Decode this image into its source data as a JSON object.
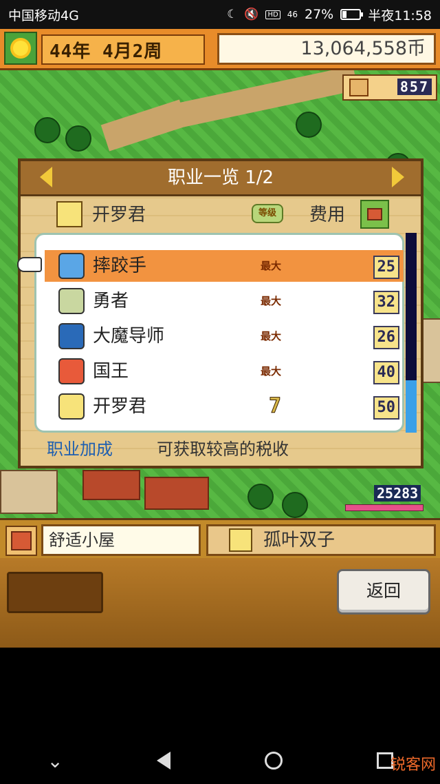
{
  "status_bar": {
    "carrier": "中国移动4G",
    "network": "46",
    "battery": "27%",
    "battery_level": 0.27,
    "time": "半夜11:58"
  },
  "top_bar": {
    "date": "44年 4月2周",
    "money": "13,064,558币",
    "population": "857"
  },
  "job_panel": {
    "title": "职业一览 1/2",
    "current_name": "开罗君",
    "level_badge": "等级",
    "cost_header": "费用",
    "jobs": [
      {
        "name": "摔跤手",
        "level": "最大",
        "cost": "25",
        "selected": true
      },
      {
        "name": "勇者",
        "level": "最大",
        "cost": "32",
        "selected": false
      },
      {
        "name": "大魔导师",
        "level": "最大",
        "cost": "26",
        "selected": false
      },
      {
        "name": "国王",
        "level": "最大",
        "cost": "40",
        "selected": false
      },
      {
        "name": "开罗君",
        "level": "7",
        "cost": "50",
        "selected": false
      }
    ],
    "bonus_label": "职业加成",
    "bonus_desc": "可获取较高的税收"
  },
  "game_overlay": {
    "score": "25283"
  },
  "bottom_info": {
    "house": "舒适小屋",
    "resident": "孤叶双子"
  },
  "buttons": {
    "return": "返回"
  },
  "watermark": "锐客网",
  "colors": {
    "selected_row": "#f29340",
    "accent": "#e88c2a"
  }
}
